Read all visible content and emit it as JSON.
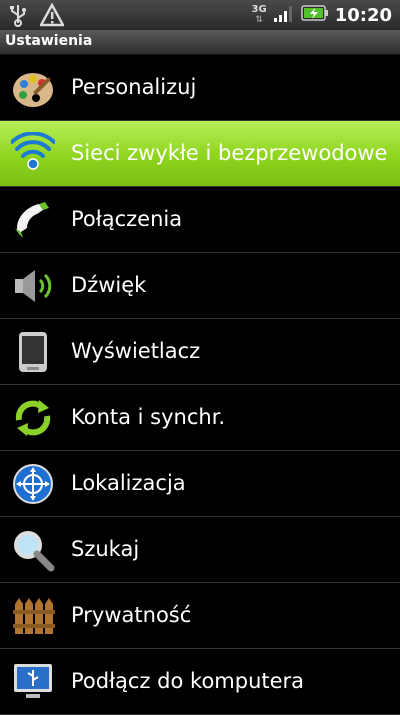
{
  "status_bar": {
    "network": "3G",
    "time": "10:20"
  },
  "title": "Ustawienia",
  "menu": [
    {
      "label": "Personalizuj",
      "icon": "palette-icon"
    },
    {
      "label": "Sieci zwykłe i bezprzewodowe",
      "icon": "wifi-icon",
      "selected": true
    },
    {
      "label": "Połączenia",
      "icon": "phone-icon"
    },
    {
      "label": "Dźwięk",
      "icon": "speaker-icon"
    },
    {
      "label": "Wyświetlacz",
      "icon": "display-icon"
    },
    {
      "label": "Konta i synchr.",
      "icon": "sync-icon"
    },
    {
      "label": "Lokalizacja",
      "icon": "location-icon"
    },
    {
      "label": "Szukaj",
      "icon": "search-icon"
    },
    {
      "label": "Prywatność",
      "icon": "fence-icon"
    },
    {
      "label": "Podłącz do komputera",
      "icon": "usb-computer-icon"
    }
  ],
  "colors": {
    "selected": "#8fd41e",
    "background": "#000000"
  }
}
